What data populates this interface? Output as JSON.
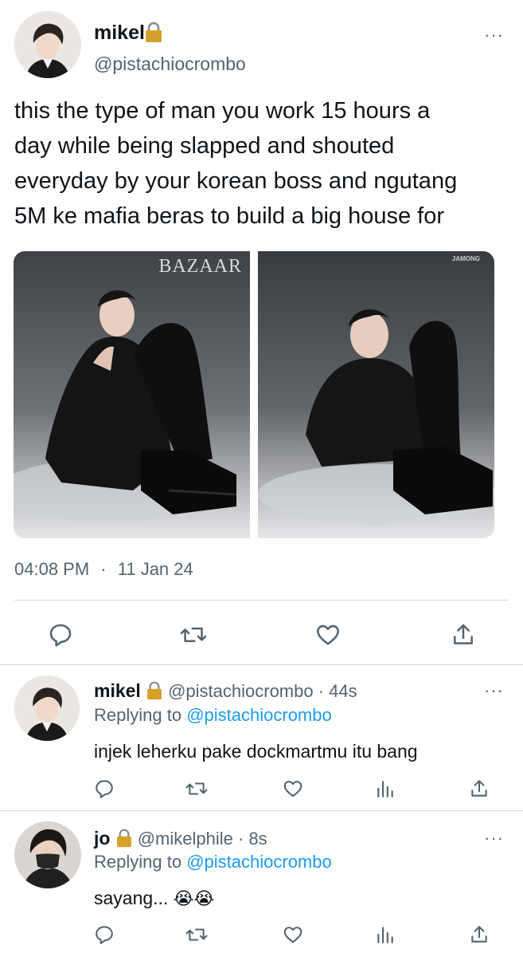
{
  "main_tweet": {
    "author_name": "mikel",
    "author_handle": "@pistachiocrombo",
    "text_lines": [
      "this the type of man you work 15 hours a",
      "day while being slapped and shouted",
      "everyday by your korean boss and ngutang",
      "5M ke mafia beras to build a big house for"
    ],
    "photo1_brand": "BAZAAR",
    "photo2_brand": "JAMONG",
    "time": "04:08 PM",
    "separator": "·",
    "date": "11 Jan 24",
    "more_label": "···"
  },
  "replies": [
    {
      "author_name": "mikel",
      "author_handle": "@pistachiocrombo",
      "age": "· 44s",
      "replying_prefix": "Replying to",
      "replying_handle": "@pistachiocrombo",
      "text": "injek leherku pake dockmartmu itu bang",
      "more_label": "···"
    },
    {
      "author_name": "jo",
      "author_handle": "@mikelphile",
      "age": "· 8s",
      "replying_prefix": "Replying to",
      "replying_handle": "@pistachiocrombo",
      "text": "sayang...",
      "emoji": "😭😭",
      "more_label": "···"
    }
  ],
  "icons": {
    "reply": "reply-icon",
    "retweet": "retweet-icon",
    "like": "heart-icon",
    "analytics": "analytics-icon",
    "share": "share-icon",
    "lock": "lock-icon"
  },
  "colors": {
    "text": "#0f1419",
    "secondary": "#536471",
    "link": "#1d9bf0",
    "divider": "#cfd9de",
    "lock": "#d4a22b"
  }
}
